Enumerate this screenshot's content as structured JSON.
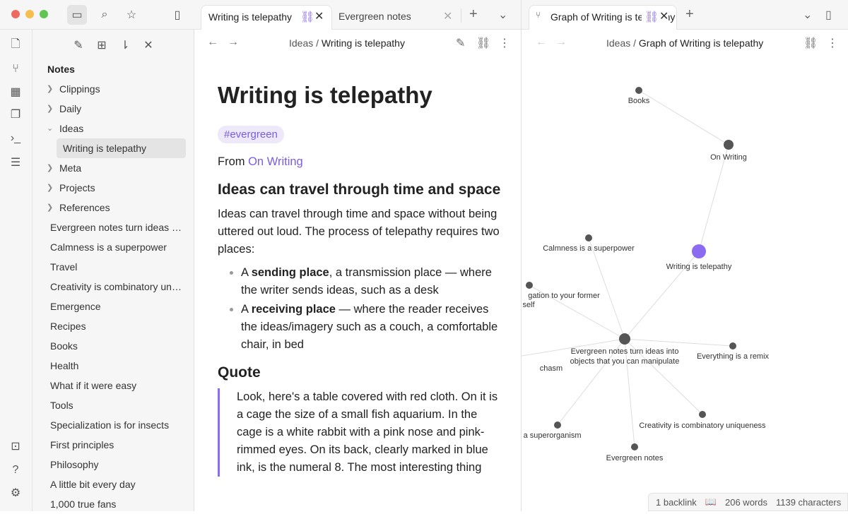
{
  "sidebar": {
    "title": "Notes",
    "folders": [
      "Clippings",
      "Daily",
      "Ideas"
    ],
    "active_file": "Writing is telepathy",
    "folders2": [
      "Meta",
      "Projects",
      "References"
    ],
    "files": [
      "Evergreen notes turn ideas into objects that you can manipulate",
      "Calmness is a superpower",
      "Travel",
      "Creativity is combinatory uniqueness",
      "Emergence",
      "Recipes",
      "Books",
      "Health",
      "What if it were easy",
      "Tools",
      "Specialization is for insects",
      "First principles",
      "Philosophy",
      "A little bit every day",
      "1,000 true fans"
    ]
  },
  "tabs": {
    "left": [
      "Writing is telepathy",
      "Evergreen notes"
    ],
    "right": [
      "Graph of Writing is telepathy"
    ]
  },
  "editor": {
    "breadcrumb_parent": "Ideas",
    "breadcrumb_current": "Writing is telepathy",
    "title": "Writing is telepathy",
    "tag": "#evergreen",
    "from_label": "From",
    "from_link": "On Writing",
    "h2_1": "Ideas can travel through time and space",
    "p1": "Ideas can travel through time and space without being uttered out loud. The process of telepathy requires two places:",
    "li1_a": "A",
    "li1_b": "sending place",
    "li1_c": ", a transmission place — where the writer sends ideas, such as a desk",
    "li2_a": "A",
    "li2_b": "receiving place",
    "li2_c": " — where the reader receives the ideas/imagery such as a couch, a comfortable chair, in bed",
    "h2_2": "Quote",
    "quote": "Look, here's a table covered with red cloth. On it is a cage the size of a small fish aquarium. In the cage is a white rabbit with a pink nose and pink-rimmed eyes. On its back, clearly marked in blue ink, is the numeral 8. The most interesting thing"
  },
  "graph": {
    "breadcrumb_parent": "Ideas",
    "breadcrumb_current": "Graph of Writing is telepathy",
    "accent": "#8b6cf0",
    "nodes": [
      "Books",
      "On Writing",
      "Writing is telepathy",
      "Calmness is a superpower",
      "gation to your former self",
      "Evergreen notes turn ideas into objects that you can manipulate",
      "Everything is a remix",
      "chasm",
      "Creativity is combinatory uniqueness",
      "mpany is a superorganism",
      "Evergreen notes"
    ]
  },
  "status": {
    "backlinks": "1 backlink",
    "words": "206 words",
    "characters": "1139 characters"
  }
}
